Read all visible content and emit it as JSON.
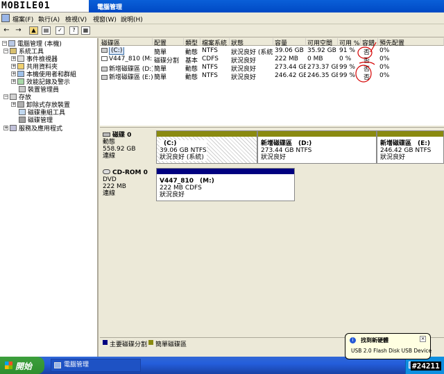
{
  "watermark": {
    "logo": "MOBILE01"
  },
  "window": {
    "title": "電腦管理"
  },
  "menu": [
    "檔案(F)",
    "執行(A)",
    "檢視(V)",
    "視窗(W)",
    "說明(H)"
  ],
  "tree": [
    {
      "label": "電腦管理 (本機)",
      "indent": 0,
      "expander": "−"
    },
    {
      "label": "系統工具",
      "indent": 1,
      "expander": "−"
    },
    {
      "label": "事件檢視器",
      "indent": 2,
      "expander": "+"
    },
    {
      "label": "共用資料夾",
      "indent": 2,
      "expander": "+"
    },
    {
      "label": "本機使用者和群組",
      "indent": 2,
      "expander": "+"
    },
    {
      "label": "效能記錄及警示",
      "indent": 2,
      "expander": "+"
    },
    {
      "label": "裝置管理員",
      "indent": 2,
      "expander": ""
    },
    {
      "label": "存放",
      "indent": 1,
      "expander": "−"
    },
    {
      "label": "卸除式存放裝置",
      "indent": 2,
      "expander": "+"
    },
    {
      "label": "磁碟重組工具",
      "indent": 2,
      "expander": ""
    },
    {
      "label": "磁碟管理",
      "indent": 2,
      "expander": ""
    },
    {
      "label": "服務及應用程式",
      "indent": 1,
      "expander": "+"
    }
  ],
  "volume_table": {
    "headers": [
      "磁碟區",
      "配置",
      "類型",
      "檔案系統",
      "狀態",
      "容量",
      "可用空間",
      "可用 %",
      "容錯",
      "預先配置"
    ],
    "rows": [
      [
        "(C:)",
        "簡單",
        "動態",
        "NTFS",
        "狀況良好 (系統)",
        "39.06 GB",
        "35.92 GB",
        "91 %",
        "否",
        "0%"
      ],
      [
        "V447_810 (M:)",
        "磁碟分割",
        "基本",
        "CDFS",
        "狀況良好",
        "222 MB",
        "0 MB",
        "0 %",
        "否",
        "0%"
      ],
      [
        "新增磁碟區 (D:)",
        "簡單",
        "動態",
        "NTFS",
        "狀況良好",
        "273.44 GB",
        "273.37 GB",
        "99 %",
        "否",
        "0%"
      ],
      [
        "新增磁碟區 (E:)",
        "簡單",
        "動態",
        "NTFS",
        "狀況良好",
        "246.42 GB",
        "246.35 GB",
        "99 %",
        "否",
        "0%"
      ]
    ]
  },
  "disks": {
    "disk0": {
      "name": "磁碟 0",
      "info": [
        "動態",
        "558.92 GB",
        "連線"
      ],
      "partitions": [
        {
          "name": "(C:)",
          "size": "39.06 GB NTFS",
          "status": "狀況良好 (系統)"
        },
        {
          "name": "新增磁碟區　(D:)",
          "size": "273.44 GB NTFS",
          "status": "狀況良好"
        },
        {
          "name": "新增磁碟區　(E:)",
          "size": "246.42 GB NTFS",
          "status": "狀況良好"
        }
      ]
    },
    "cdrom0": {
      "name": "CD-ROM 0",
      "info": [
        "DVD",
        "222 MB",
        "連線"
      ],
      "partition": {
        "name": "V447_810　(M:)",
        "size": "222 MB CDFS",
        "status": "狀況良好"
      }
    }
  },
  "legend": {
    "primary": "主要磁碟分割",
    "simple": "簡單磁碟區"
  },
  "colors": {
    "primary": "#000080",
    "simple": "#8a8a10",
    "annotation": "#d40000"
  },
  "taskbar": {
    "start": "開始",
    "task": "電腦管理"
  },
  "balloon": {
    "title": "找到新硬體",
    "message": "USB 2.0 Flash Disk USB Device",
    "close": "×"
  },
  "badge": "#24211"
}
